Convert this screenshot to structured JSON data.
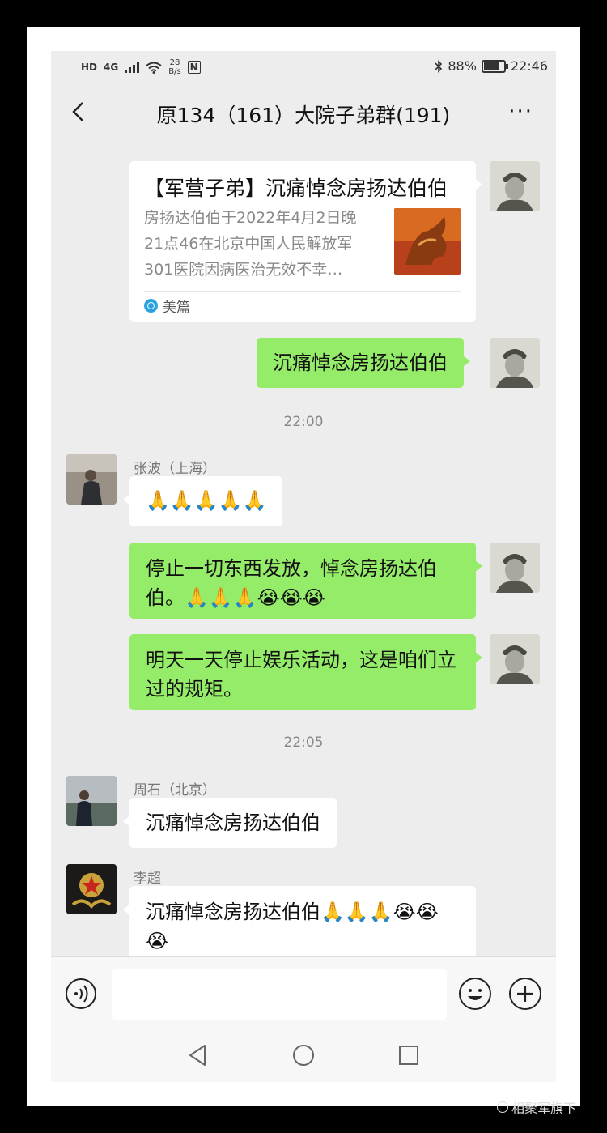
{
  "status_bar": {
    "left_badges": [
      "HD",
      "4G"
    ],
    "net_speed_value": "28",
    "net_speed_unit": "B/s",
    "nfc": "N",
    "battery": "88%",
    "battery_level": 0.88,
    "time": "22:46"
  },
  "header": {
    "title": "原134（161）大院子弟群(191)",
    "more": "···"
  },
  "link_card": {
    "title": "【军营子弟】沉痛悼念房扬达伯伯",
    "description": "房扬达伯伯于2022年4月2日晚21点46在北京中国人民解放军301医院因病医治无效不幸…",
    "source": "美篇"
  },
  "messages": [
    {
      "text": "沉痛悼念房扬达伯伯"
    },
    {
      "time": "22:00"
    },
    {
      "sender": "张波（上海）",
      "text": "🙏🙏🙏🙏🙏"
    },
    {
      "text": "停止一切东西发放，悼念房扬达伯伯。🙏🙏🙏😭😭😭"
    },
    {
      "text": "明天一天停止娱乐活动，这是咱们立过的规矩。"
    },
    {
      "time": "22:05"
    },
    {
      "sender": "周石（北京）",
      "text": "沉痛悼念房扬达伯伯"
    },
    {
      "sender": "李超",
      "text": "沉痛悼念房扬达伯伯🙏🙏🙏😭😭😭"
    }
  ],
  "watermark": "相聚军旗下",
  "icons": {
    "back": "back-arrow-icon",
    "more": "more-dots-icon",
    "voice": "voice-icon",
    "emoji": "emoji-icon",
    "plus": "plus-icon",
    "nav_back": "triangle-back-icon",
    "nav_home": "circle-home-icon",
    "nav_recent": "square-recent-icon"
  },
  "colors": {
    "my_bubble": "#95ec69",
    "other_bubble": "#ffffff",
    "chat_background": "#ededed"
  }
}
